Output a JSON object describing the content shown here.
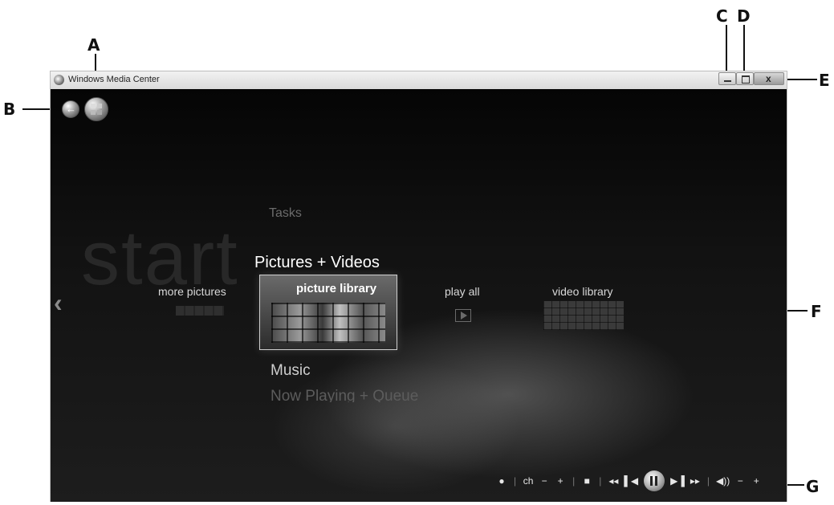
{
  "callouts": {
    "a": "A",
    "b": "B",
    "c": "C",
    "d": "D",
    "e": "E",
    "f": "F",
    "g": "G"
  },
  "window": {
    "title": "Windows Media Center",
    "minimize_icon": "minimize-icon",
    "maximize_icon": "maximize-icon",
    "close_icon": "close-icon",
    "close_glyph": "x"
  },
  "nav": {
    "back_glyph": "←",
    "start_icon": "windows-start-icon"
  },
  "start_menu": {
    "watermark": "start",
    "items_above": "Tasks",
    "selected_row": "Pictures + Videos",
    "row_below": "Music",
    "row_below_2": "Now Playing + Queue",
    "scroll_left_glyph": "‹",
    "tiles": {
      "more_pictures": "more pictures",
      "picture_library": "picture library",
      "play_all": "play all",
      "video_library": "video library"
    }
  },
  "transport": {
    "record": "●",
    "sep": "|",
    "ch_label": "ch",
    "ch_minus": "−",
    "ch_plus": "+",
    "stop": "■",
    "rewind": "◂◂",
    "prev": "▌◀",
    "next": "▶▐",
    "fast_forward": "▸▸",
    "mute": "◀))",
    "vol_minus": "−",
    "vol_plus": "+"
  },
  "colors": {
    "background": "#111111",
    "title_bar": "#e4e4e4",
    "text_primary": "#ffffff",
    "text_dim": "#6b6b6b"
  }
}
